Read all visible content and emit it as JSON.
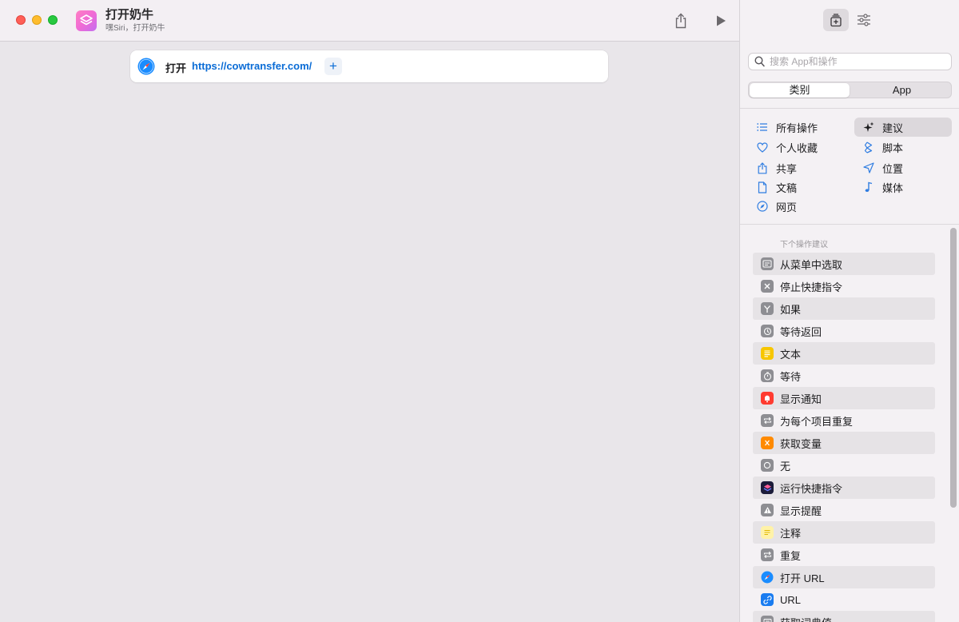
{
  "window": {
    "title": "打开奶牛",
    "subtitle": "嘿Siri，打开奶牛"
  },
  "action": {
    "verb": "打开",
    "url": "https://cowtransfer.com/",
    "add_symbol": "+"
  },
  "sidebar": {
    "search_placeholder": "搜索 App和操作",
    "segments": [
      "类别",
      "App"
    ],
    "categories": [
      {
        "label": "所有操作",
        "icon": "list-icon"
      },
      {
        "label": "建议",
        "icon": "sparkle-icon",
        "selected": true
      },
      {
        "label": "个人收藏",
        "icon": "heart-icon"
      },
      {
        "label": "脚本",
        "icon": "script-icon"
      },
      {
        "label": "共享",
        "icon": "share-icon"
      },
      {
        "label": "位置",
        "icon": "location-icon"
      },
      {
        "label": "文稿",
        "icon": "document-icon"
      },
      {
        "label": "媒体",
        "icon": "music-note-icon"
      },
      {
        "label": "网页",
        "icon": "compass-icon"
      }
    ],
    "suggest_header": "下个操作建议",
    "suggestions": [
      {
        "label": "从菜单中选取",
        "icon": "menu-icon",
        "color": "#8e8e93"
      },
      {
        "label": "停止快捷指令",
        "icon": "stop-icon",
        "color": "#8e8e93"
      },
      {
        "label": "如果",
        "icon": "branch-icon",
        "color": "#8e8e93"
      },
      {
        "label": "等待返回",
        "icon": "history-icon",
        "color": "#8e8e93"
      },
      {
        "label": "文本",
        "icon": "text-icon",
        "color": "#f7c600"
      },
      {
        "label": "等待",
        "icon": "timer-icon",
        "color": "#8e8e93"
      },
      {
        "label": "显示通知",
        "icon": "notification-icon",
        "color": "#ff3b30"
      },
      {
        "label": "为每个项目重复",
        "icon": "repeat-each-icon",
        "color": "#8e8e93"
      },
      {
        "label": "获取变量",
        "icon": "variable-icon",
        "color": "#ff8a00"
      },
      {
        "label": "无",
        "icon": "nothing-icon",
        "color": "#8e8e93"
      },
      {
        "label": "运行快捷指令",
        "icon": "shortcuts-icon",
        "color": "#1c1c3a"
      },
      {
        "label": "显示提醒",
        "icon": "alert-icon",
        "color": "#8e8e93"
      },
      {
        "label": "注释",
        "icon": "comment-icon",
        "color": "#fff2a8"
      },
      {
        "label": "重复",
        "icon": "repeat-icon",
        "color": "#8e8e93"
      },
      {
        "label": "打开 URL",
        "icon": "safari-icon",
        "color": "#1a8cff"
      },
      {
        "label": "URL",
        "icon": "link-icon",
        "color": "#1a7cf0"
      },
      {
        "label": "获取词典值",
        "icon": "dictionary-icon",
        "color": "#8e8e93"
      }
    ]
  }
}
